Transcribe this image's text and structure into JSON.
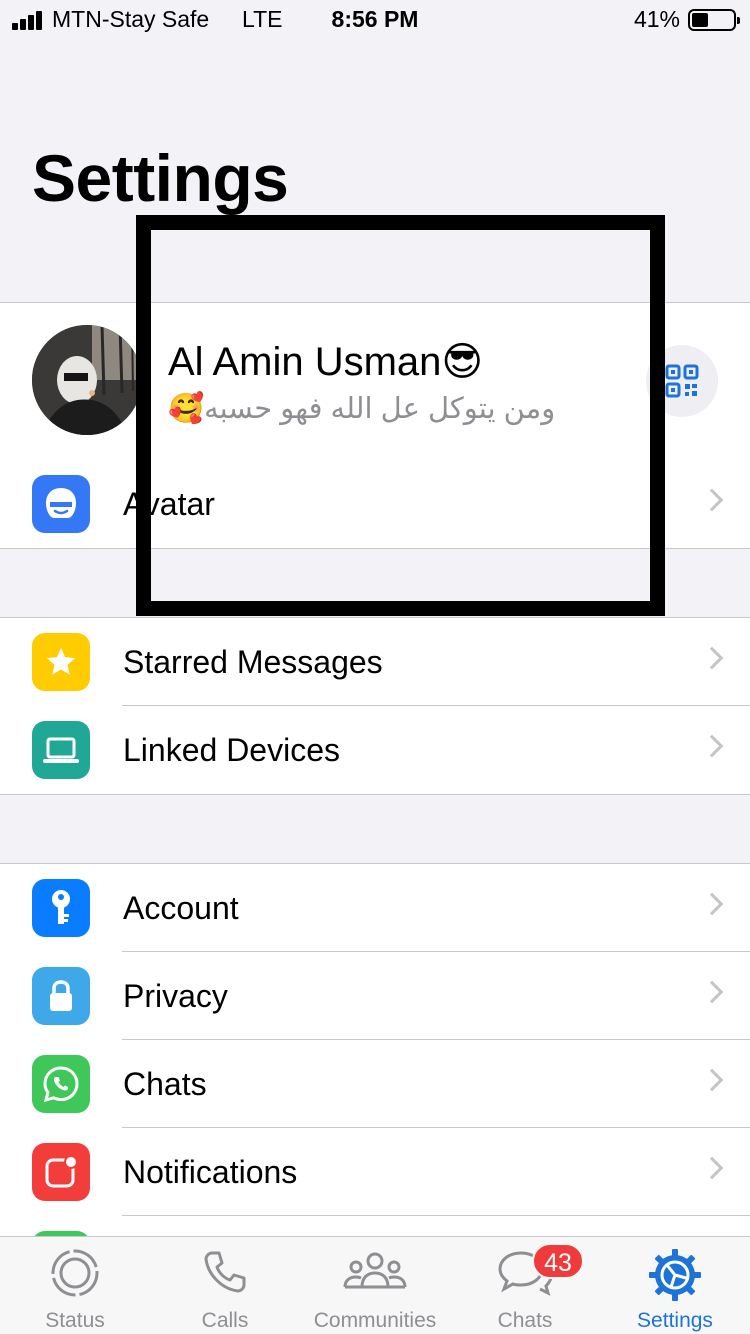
{
  "status_bar": {
    "carrier": "MTN-Stay Safe",
    "network": "LTE",
    "time": "8:56 PM",
    "battery_percent": "41%",
    "battery_level": 0.41
  },
  "page_title": "Settings",
  "profile": {
    "name": "Al Amin Usman😎",
    "about": "ومن يتوكل عل الله فهو حسبه🥰",
    "avatar_icon": "profile-photo",
    "qr_icon": "qr-code-icon"
  },
  "groups": {
    "avatar": {
      "label": "Avatar",
      "icon": "avatar-icon",
      "color": "#3478f6"
    },
    "starred": {
      "label": "Starred Messages",
      "icon": "star-icon",
      "color": "#fecc00"
    },
    "linked": {
      "label": "Linked Devices",
      "icon": "laptop-icon",
      "color": "#21a796"
    },
    "account": {
      "label": "Account",
      "icon": "key-icon",
      "color": "#0a7cff"
    },
    "privacy": {
      "label": "Privacy",
      "icon": "lock-icon",
      "color": "#3ea8e8"
    },
    "chats": {
      "label": "Chats",
      "icon": "whatsapp-icon",
      "color": "#40c75a"
    },
    "notifications": {
      "label": "Notifications",
      "icon": "notification-icon",
      "color": "#f33d3b"
    }
  },
  "tabbar": {
    "tabs": [
      {
        "label": "Status",
        "icon": "status-icon"
      },
      {
        "label": "Calls",
        "icon": "phone-icon"
      },
      {
        "label": "Communities",
        "icon": "communities-icon"
      },
      {
        "label": "Chats",
        "icon": "chat-bubbles-icon",
        "badge": "43"
      },
      {
        "label": "Settings",
        "icon": "gear-icon",
        "active": true
      }
    ],
    "active_color": "#1d73d8",
    "inactive_color": "#8e8e93"
  }
}
